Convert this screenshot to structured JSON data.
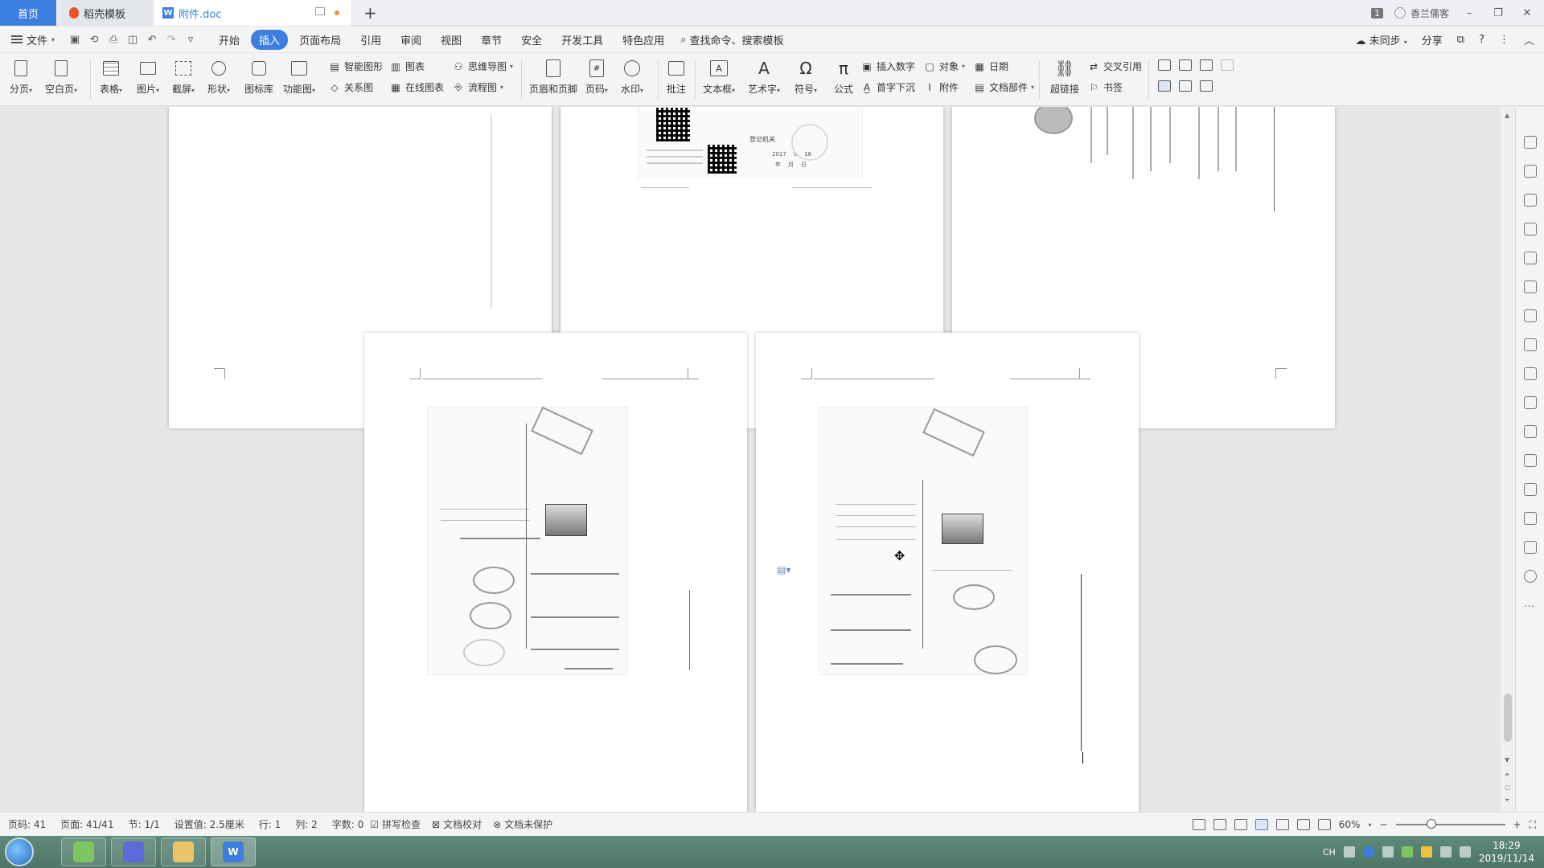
{
  "tabs": {
    "home": "首页",
    "template": "稻壳模板",
    "document": "附件.doc"
  },
  "titlebar": {
    "badge": "1",
    "user": "香兰儒客"
  },
  "menu": {
    "file": "文件",
    "tabs": [
      "开始",
      "插入",
      "页面布局",
      "引用",
      "审阅",
      "视图",
      "章节",
      "安全",
      "开发工具",
      "特色应用"
    ],
    "active_tab": "插入",
    "search": "查找命令、搜索模板",
    "sync": "未同步",
    "share": "分享"
  },
  "ribbon": {
    "page_break": "分页",
    "blank_page": "空白页",
    "table": "表格",
    "picture": "图片",
    "screenshot": "截屏",
    "shape": "形状",
    "icon_lib": "图标库",
    "func_chart": "功能图",
    "smart_shape": "智能图形",
    "chart": "图表",
    "mind_map": "思维导图",
    "relation": "关系图",
    "online_chart": "在线图表",
    "flowchart": "流程图",
    "header_footer": "页眉和页脚",
    "page_num": "页码",
    "watermark": "水印",
    "comment": "批注",
    "textbox": "文本框",
    "art_text": "艺术字",
    "symbol": "符号",
    "formula": "公式",
    "insert_number": "插入数字",
    "drop_cap": "首字下沉",
    "object": "对象",
    "attachment": "附件",
    "date": "日期",
    "doc_parts": "文档部件",
    "hyperlink": "超链接",
    "cross_ref": "交叉引用",
    "bookmark": "书签"
  },
  "page2": {
    "heading": "登记机关",
    "date_numbers": "2017    9    18",
    "date_labels": "年    月    日"
  },
  "status": {
    "page_code": "页码: 41",
    "page": "页面: 41/41",
    "section": "节: 1/1",
    "setting": "设置值: 2.5厘米",
    "row": "行: 1",
    "col": "列: 2",
    "word_count": "字数: 0",
    "spell_check": "拼写检查",
    "doc_proof": "文档校对",
    "doc_protect": "文档未保护",
    "zoom": "60%"
  },
  "taskbar": {
    "lang": "CH",
    "time": "18:29",
    "date": "2019/11/14"
  },
  "colors": {
    "accent": "#3d7fe0",
    "taskbar": "#5a8474"
  }
}
